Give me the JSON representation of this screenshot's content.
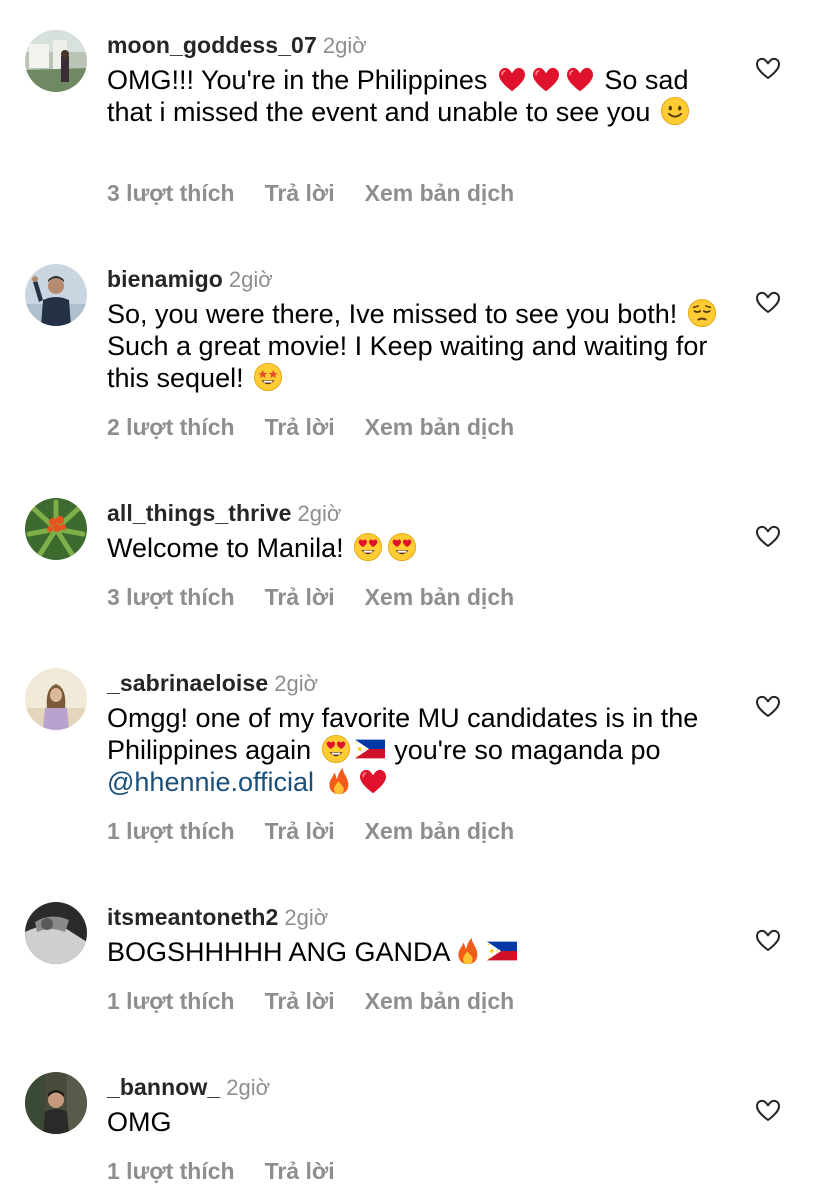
{
  "comments": [
    {
      "username": "moon_goddess_07",
      "time": "2giờ",
      "text_parts": [
        "OMG!!! You're in the Philippines",
        "So sad that i missed the event and unable to see you"
      ],
      "likes": "3 lượt thích",
      "reply": "Trả lời",
      "translate": "Xem bản dịch"
    },
    {
      "username": "bienamigo",
      "time": "2giờ",
      "text_parts": [
        "So, you were there, Ive missed to see you both!",
        "Such a great movie! I Keep waiting and waiting for this sequel!"
      ],
      "likes": "2 lượt thích",
      "reply": "Trả lời",
      "translate": "Xem bản dịch"
    },
    {
      "username": "all_things_thrive",
      "time": "2giờ",
      "text_parts": [
        "Welcome to Manila!"
      ],
      "likes": "3 lượt thích",
      "reply": "Trả lời",
      "translate": "Xem bản dịch"
    },
    {
      "username": "_sabrinaeloise",
      "time": "2giờ",
      "text_parts": [
        "Omgg! one of my favorite MU candidates is in the Philippines again",
        "you're so maganda po",
        "@hhennie.official"
      ],
      "likes": "1 lượt thích",
      "reply": "Trả lời",
      "translate": "Xem bản dịch"
    },
    {
      "username": "itsmeantoneth2",
      "time": "2giờ",
      "text_parts": [
        "BOGSHHHHH ANG GANDA"
      ],
      "likes": "1 lượt thích",
      "reply": "Trả lời",
      "translate": "Xem bản dịch"
    },
    {
      "username": "_bannow_",
      "time": "2giờ",
      "text_parts": [
        "OMG"
      ],
      "likes": "1 lượt thích",
      "reply": "Trả lời"
    }
  ],
  "icons": {
    "like": "heart-outline-icon",
    "emoji_heart": "red-heart-emoji",
    "emoji_smile": "slightly-smiling-face-emoji",
    "emoji_pensive": "pensive-face-emoji",
    "emoji_starstruck": "star-struck-emoji",
    "emoji_hearteyes": "heart-eyes-emoji",
    "emoji_flag": "philippines-flag-emoji",
    "emoji_fire": "fire-emoji"
  },
  "colors": {
    "username": "#262626",
    "meta": "#8e8e8e",
    "mention": "#1a4f7a"
  }
}
